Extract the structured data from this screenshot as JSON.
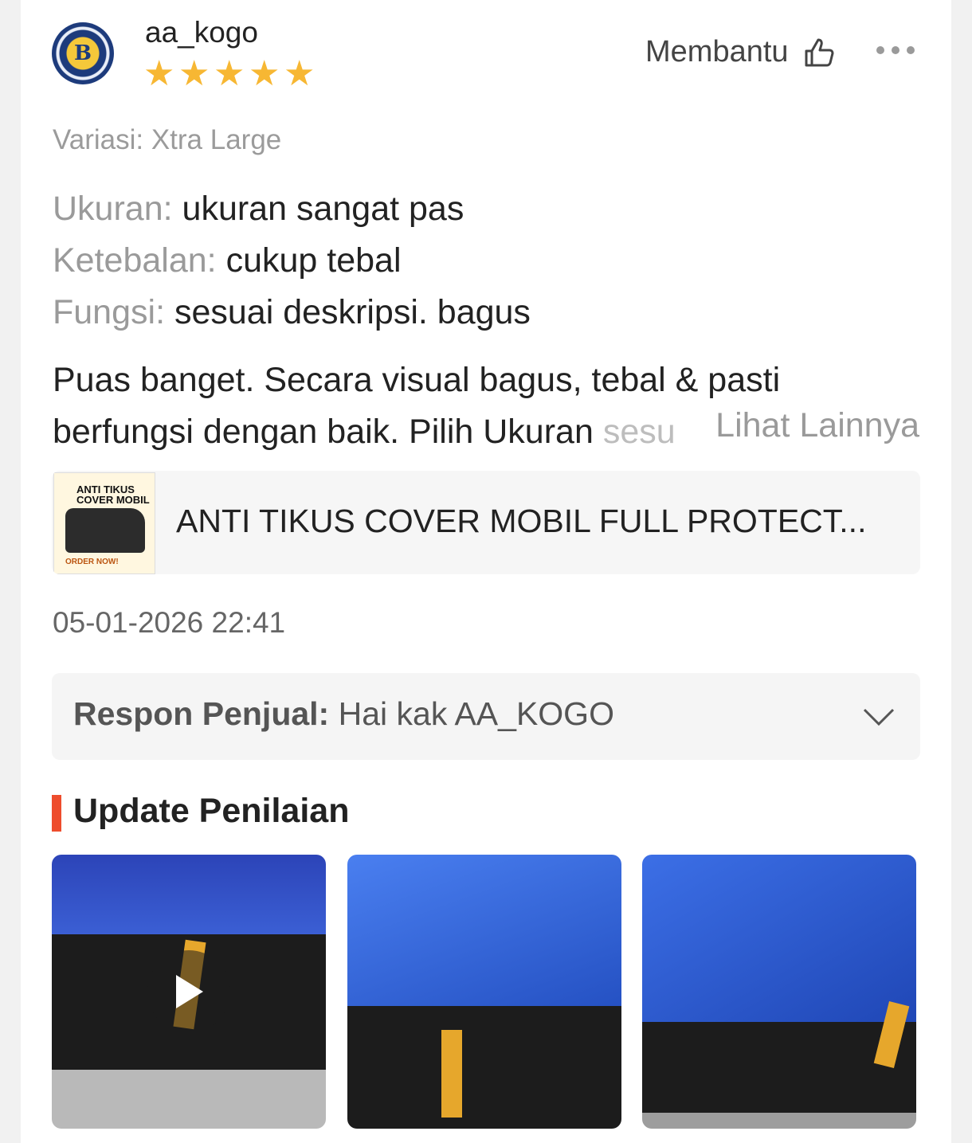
{
  "review": {
    "username": "aa_kogo",
    "rating": 5,
    "stars": [
      "★",
      "★",
      "★",
      "★",
      "★"
    ],
    "helpful_label": "Membantu",
    "variation": "Variasi: Xtra Large",
    "attributes": [
      {
        "label": "Ukuran:",
        "value": "ukuran sangat pas"
      },
      {
        "label": "Ketebalan:",
        "value": "cukup tebal"
      },
      {
        "label": "Fungsi:",
        "value": "sesuai deskripsi. bagus"
      }
    ],
    "text_line1": "Puas banget. Secara visual bagus, tebal & pasti",
    "text_line2": "berfungsi dengan baik. Pilih Ukuran ",
    "text_line2_fade": "sesu",
    "see_more": "Lihat Lainnya",
    "date": "05-01-2026 22:41"
  },
  "product": {
    "name": "ANTI TIKUS COVER MOBIL FULL PROTECT...",
    "thumb_title_1": "ANTI TIKUS",
    "thumb_title_2": "COVER MOBIL",
    "thumb_order": "ORDER NOW!"
  },
  "seller_response": {
    "label": "Respon Penjual:",
    "text": " Hai kak AA_KOGO"
  },
  "update": {
    "title": "Update Penilaian",
    "media": [
      {
        "type": "video",
        "name": "update-video"
      },
      {
        "type": "image",
        "name": "update-photo-2"
      },
      {
        "type": "image",
        "name": "update-photo-3"
      }
    ]
  },
  "colors": {
    "star": "#f7b733",
    "accent": "#ee4d2d",
    "cover_blue": "#2a55c9"
  },
  "icons": [
    "thumbs-up-icon",
    "more-icon",
    "chevron-down-icon",
    "play-icon"
  ]
}
